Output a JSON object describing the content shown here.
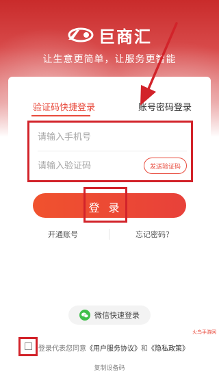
{
  "header": {
    "logo_text": "巨商汇",
    "tagline": "让生意更简单，让服务更智能"
  },
  "tabs": {
    "sms_login": "验证码快捷登录",
    "password_login": "账号密码登录"
  },
  "form": {
    "phone_placeholder": "请输入手机号",
    "code_placeholder": "请输入验证码",
    "send_code": "发送验证码",
    "login_button": "登 录"
  },
  "links": {
    "open_account": "开通账号",
    "forgot_password": "忘记密码？"
  },
  "wechat": {
    "label": "微信快速登录"
  },
  "agreement": {
    "prefix": "登录代表您同意",
    "user_agreement": "《用户服务协议》",
    "and": "和",
    "privacy_policy": "《隐私政策》"
  },
  "footer": {
    "copy_device_code": "复制设备码",
    "watermark": "火鸟手游网"
  },
  "colors": {
    "accent": "#e84a3c",
    "highlight": "#d2232a",
    "hero": "#c92b2b"
  }
}
